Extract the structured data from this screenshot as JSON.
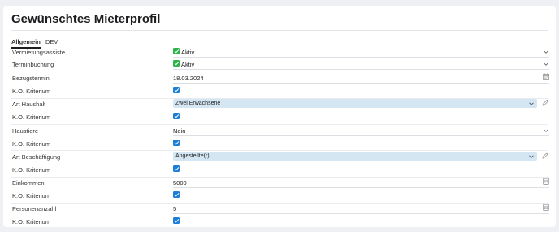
{
  "page": {
    "title": "Gewünschtes Mieterprofil"
  },
  "tabs": [
    {
      "label": "Allgemein",
      "active": true
    },
    {
      "label": "DEV",
      "active": false
    }
  ],
  "fields": {
    "vermietungsassistent": {
      "label": "Vermietungsassiste...",
      "value": "Aktiv",
      "checked": true
    },
    "terminbuchung": {
      "label": "Terminbuchung",
      "value": "Aktiv",
      "checked": true
    },
    "bezugstermin": {
      "label": "Bezugstermin",
      "value": "18.03.2024"
    },
    "bezugstermin_ko": {
      "label": "K.O. Kriterium",
      "checked": true
    },
    "art_haushalt": {
      "label": "Art Haushalt",
      "value": "Zwei Erwachsene"
    },
    "art_haushalt_ko": {
      "label": "K.O. Kriterium",
      "checked": true
    },
    "haustiere": {
      "label": "Haustiere",
      "value": "Nein"
    },
    "haustiere_ko": {
      "label": "K.O. Kriterium",
      "checked": true
    },
    "art_beschaeftigung": {
      "label": "Art Beschäftigung",
      "value": "Angestellte(r)"
    },
    "art_beschaeftigung_ko": {
      "label": "K.O. Kriterium",
      "checked": true
    },
    "einkommen": {
      "label": "Einkommen",
      "value": "5000"
    },
    "einkommen_ko": {
      "label": "K.O. Kriterium",
      "checked": true
    },
    "personenanzahl": {
      "label": "Personenanzahl",
      "value": "5"
    },
    "personenanzahl_ko": {
      "label": "K.O. Kriterium",
      "checked": true
    }
  },
  "icons": {
    "dropdown": "chevron-down-icon",
    "date": "calendar-icon",
    "edit": "pencil-icon",
    "number": "calculator-icon"
  },
  "colors": {
    "accent_blue": "#1c7ed6",
    "active_green": "#2eb24a",
    "select_bg": "#d5e6f3"
  }
}
